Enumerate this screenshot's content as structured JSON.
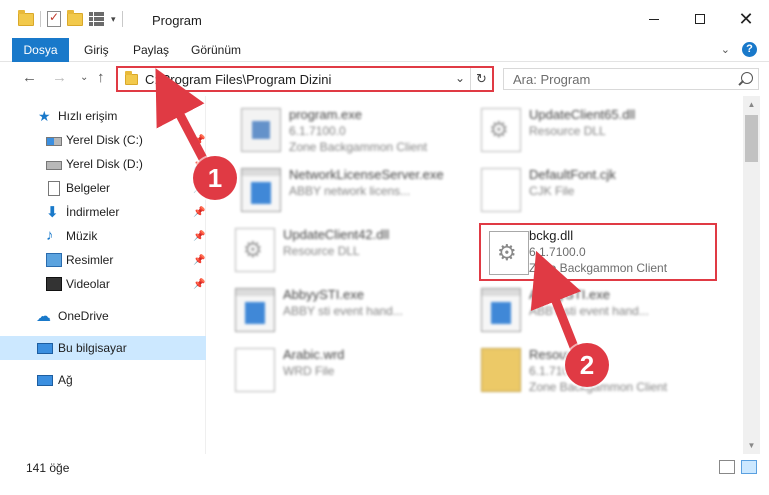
{
  "window": {
    "title": "Program",
    "accent": "#1979ca",
    "annotation_color": "#e03a44"
  },
  "ribbon": {
    "tabs": [
      {
        "label": "Dosya"
      },
      {
        "label": "Giriş"
      },
      {
        "label": "Paylaş"
      },
      {
        "label": "Görünüm"
      }
    ],
    "help_label": "?"
  },
  "address": {
    "path": "C:\\Program Files\\Program Dizini",
    "search_placeholder": "Ara: Program"
  },
  "nav": {
    "items": [
      {
        "label": "Hızlı erişim",
        "icon": "star-icon"
      },
      {
        "label": "Yerel Disk (C:)",
        "icon": "drive-c-icon"
      },
      {
        "label": "Yerel Disk (D:)",
        "icon": "drive-d-icon"
      },
      {
        "label": "Belgeler",
        "icon": "documents-icon"
      },
      {
        "label": "İndirmeler",
        "icon": "downloads-icon"
      },
      {
        "label": "Müzik",
        "icon": "music-icon"
      },
      {
        "label": "Resimler",
        "icon": "pictures-icon"
      },
      {
        "label": "Videolar",
        "icon": "videos-icon"
      },
      {
        "label": "OneDrive",
        "icon": "onedrive-icon"
      },
      {
        "label": "Bu bilgisayar",
        "icon": "this-pc-icon",
        "selected": true
      },
      {
        "label": "Ağ",
        "icon": "network-icon"
      }
    ]
  },
  "files": [
    {
      "name": "program.exe",
      "line2": "6.1.7100.0",
      "line3": "Zone Backgammon Client",
      "icon": "exe-icon"
    },
    {
      "name": "UpdateClient65.dll",
      "line2": "Resource DLL",
      "line3": "",
      "icon": "dll-icon"
    },
    {
      "name": "NetworkLicenseServer.exe",
      "line2": "ABBY network licens...",
      "line3": "",
      "icon": "window-exe-icon"
    },
    {
      "name": "DefaultFont.cjk",
      "line2": "CJK File",
      "line3": "",
      "icon": "blank-file-icon"
    },
    {
      "name": "UpdateClient42.dll",
      "line2": "Resource DLL",
      "line3": "",
      "icon": "dll-icon"
    },
    {
      "name": "bckg.dll",
      "line2": "6.1.7100.0",
      "line3": "Zone Backgammon Client",
      "icon": "dll-icon",
      "highlighted": true
    },
    {
      "name": "AbbyySTI.exe",
      "line2": "ABBY sti event hand...",
      "line3": "",
      "icon": "window-exe-icon"
    },
    {
      "name": "AbbyySTI.exe",
      "line2": "ABBY sti event hand...",
      "line3": "",
      "icon": "window-exe-icon"
    },
    {
      "name": "Arabic.wrd",
      "line2": "WRD File",
      "line3": "",
      "icon": "blank-file-icon"
    },
    {
      "name": "Resources",
      "line2": "6.1.7100.0",
      "line3": "Zone Backgammon Client",
      "icon": "zip-icon"
    }
  ],
  "status": {
    "count": "141 öğe"
  },
  "annotations": [
    {
      "label": "1"
    },
    {
      "label": "2"
    }
  ]
}
